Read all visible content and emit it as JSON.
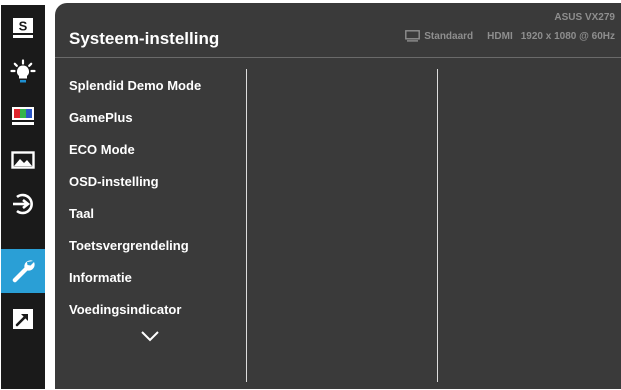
{
  "sidebar": {
    "items": [
      {
        "name": "splendid",
        "letter": "S",
        "active": false
      },
      {
        "name": "blue-light-filter",
        "active": false
      },
      {
        "name": "color",
        "active": false
      },
      {
        "name": "image",
        "active": false
      },
      {
        "name": "input-select",
        "active": false
      },
      {
        "name": "system-setup",
        "active": true
      },
      {
        "name": "shortcut",
        "active": false
      }
    ]
  },
  "header": {
    "title": "Systeem-instelling",
    "model": "ASUS VX279",
    "mode": "Standaard",
    "input": "HDMI",
    "resolution": "1920 x 1080 @ 60Hz"
  },
  "menu": {
    "items": [
      "Splendid Demo Mode",
      "GamePlus",
      "ECO Mode",
      "OSD-instelling",
      "Taal",
      "Toetsvergrendeling",
      "Informatie",
      "Voedingsindicator"
    ]
  },
  "colors": {
    "panel": "#3a3a3a",
    "sidebar": "#1a1a1a",
    "accent": "#2a9fd6",
    "text": "#ffffff",
    "status_text": "#8e8e8e"
  }
}
